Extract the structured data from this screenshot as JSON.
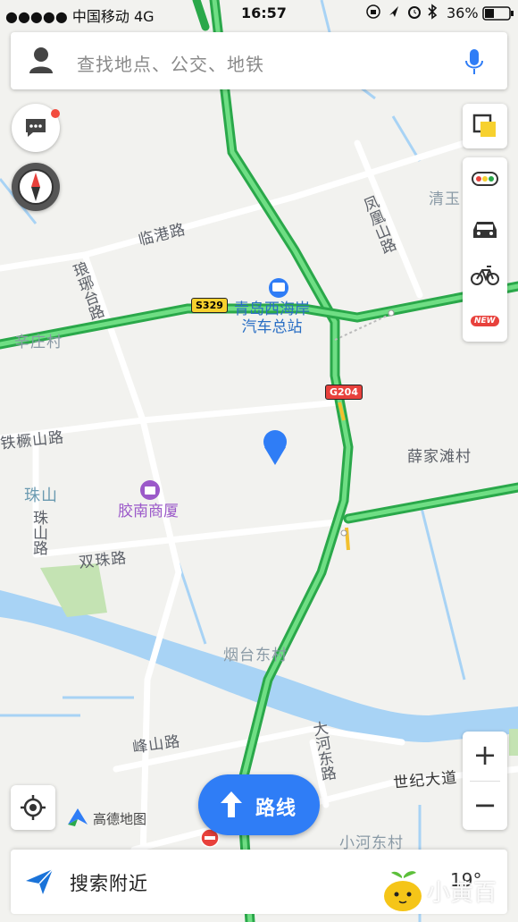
{
  "status_bar": {
    "carrier": "●●●●● 中国移动 4G",
    "time": "16:57",
    "battery": "36%",
    "icons": [
      "lock-rotation-icon",
      "location-arrow-icon",
      "alarm-icon",
      "bluetooth-icon",
      "battery-icon"
    ]
  },
  "search": {
    "placeholder": "查找地点、公交、地铁",
    "icons": [
      "user-icon",
      "microphone-icon"
    ]
  },
  "map": {
    "roads": {
      "linggang": "临港路",
      "langya": "琅琊台路",
      "fenghuangshan": "凤凰山路",
      "tiejueshan": "铁橛山路",
      "shuangzhu": "双珠路",
      "zhushan_road": "珠山路",
      "fengshan": "峰山路",
      "dahedong": "大河东路",
      "shiji": "世纪大道"
    },
    "places": {
      "xinzhuang": "辛庄村",
      "qingyu": "清玉",
      "zhushan": "珠山",
      "xuejiatan": "薛家滩村",
      "yantaidong": "烟台东村",
      "xiaohedong": "小河东村"
    },
    "pois": {
      "bus_station_line1": "青岛西海岸",
      "bus_station_line2": "汽车总站",
      "mall": "胶南商厦"
    },
    "shields": {
      "s329": "S329",
      "g204": "G204"
    }
  },
  "side_tools": [
    "layers-icon",
    "traffic-icon",
    "taxi-icon",
    "bike-icon"
  ],
  "new_badge": "NEW",
  "zoom": {
    "in": "+",
    "out": "−"
  },
  "logo": "高德地图",
  "route_button": "路线",
  "bottom_bar": {
    "label": "搜索附近",
    "temp": "19°"
  },
  "watermark": "小黄百"
}
